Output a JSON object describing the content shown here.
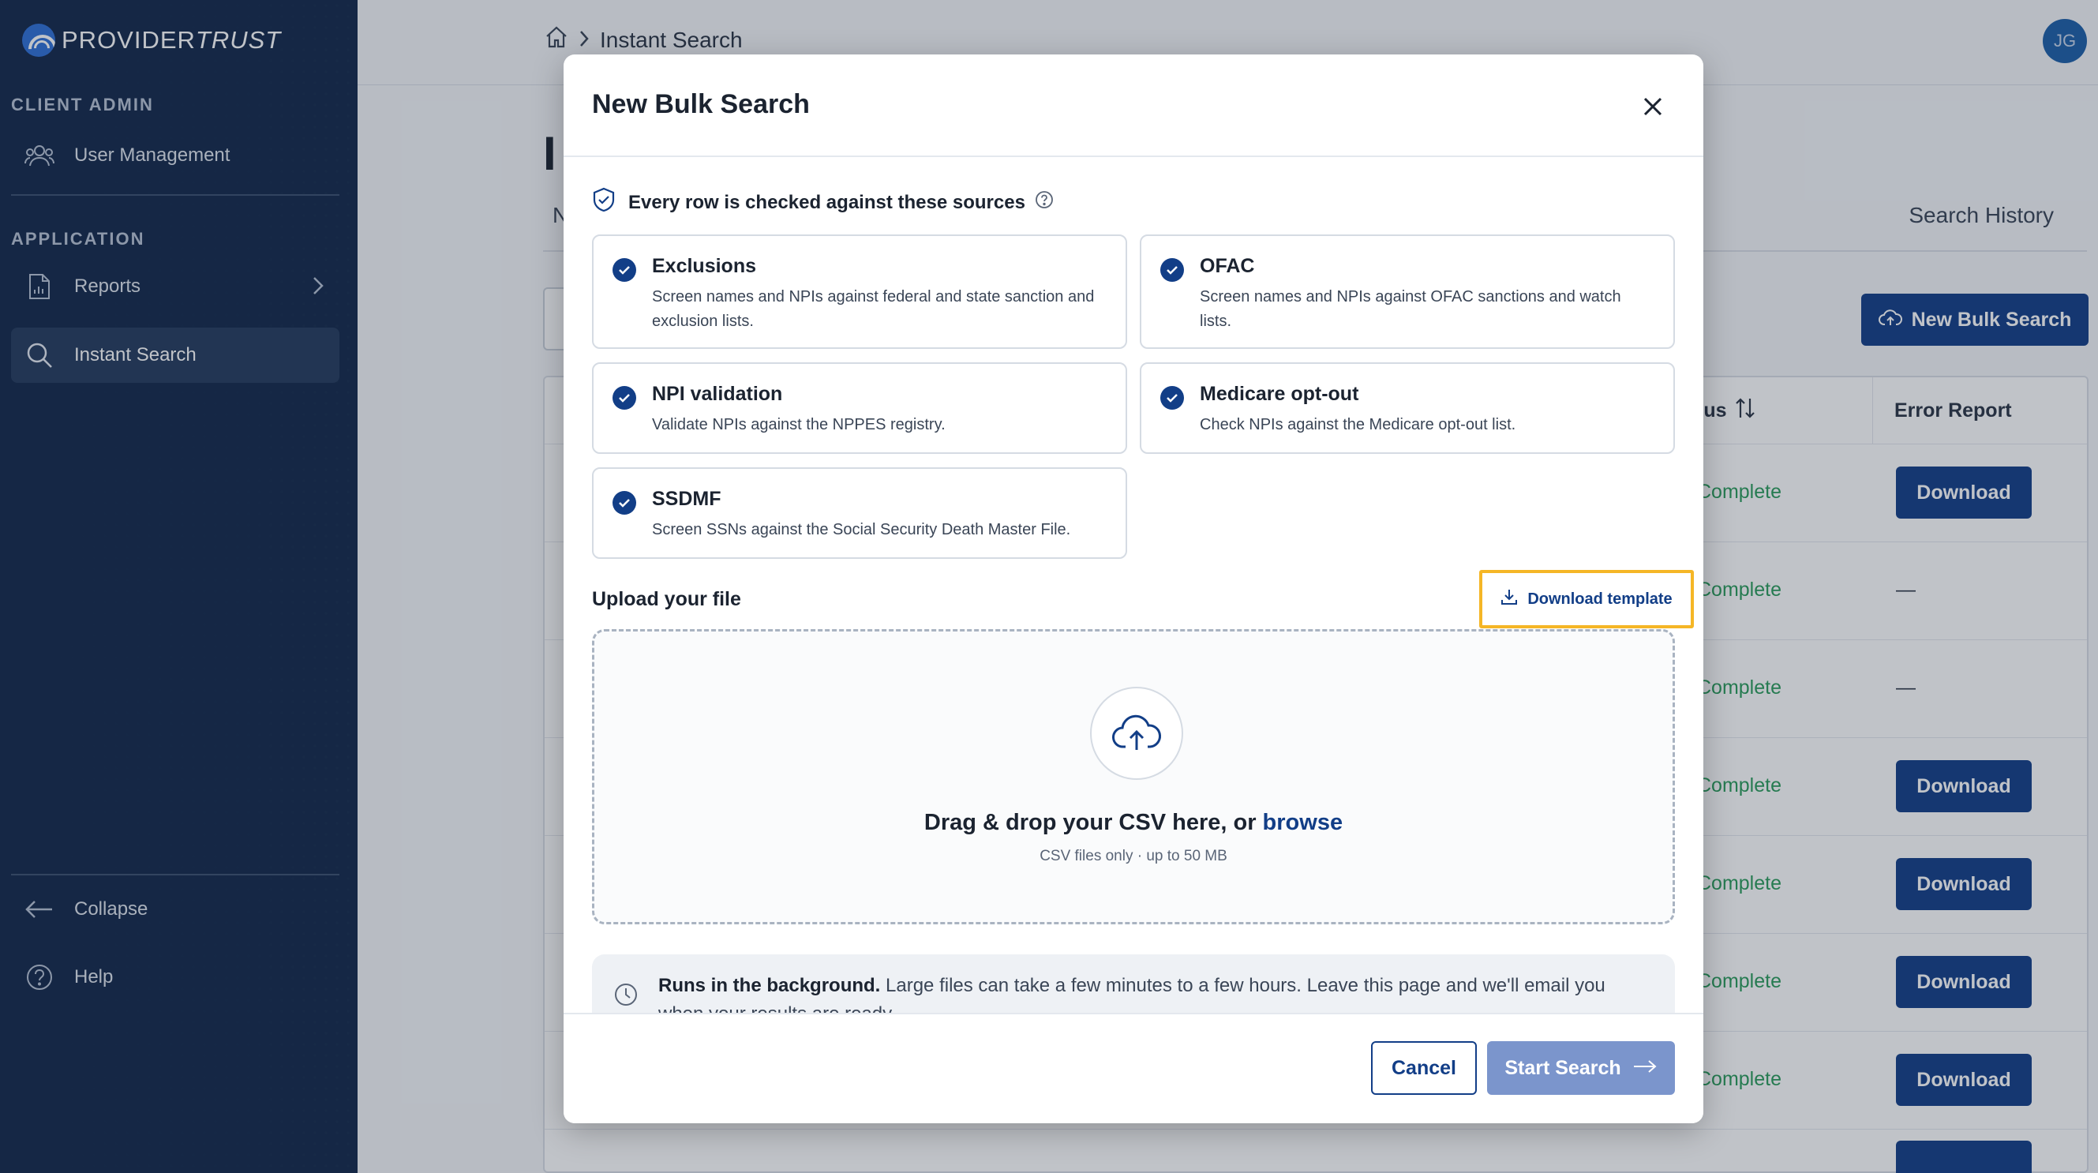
{
  "sidebar": {
    "logo_primary": "PROVIDER",
    "logo_secondary": "TRUST",
    "section_client_admin": "CLIENT ADMIN",
    "user_management": "User Management",
    "section_application": "APPLICATION",
    "reports": "Reports",
    "instant_search": "Instant Search",
    "collapse": "Collapse",
    "help": "Help"
  },
  "topbar": {
    "breadcrumb_current": "Instant Search",
    "avatar_initials": "JG"
  },
  "background": {
    "title_partial": "I",
    "tab_partial": "N",
    "tab_history": "Search History",
    "new_bulk_button": "New Bulk Search",
    "col_status_partial": "tus",
    "col_error_report": "Error Report",
    "rows": [
      {
        "status": "Complete",
        "report": "Download"
      },
      {
        "status": "Complete",
        "report": "—"
      },
      {
        "status": "Complete",
        "report": "—"
      },
      {
        "status": "Complete",
        "report": "Download"
      },
      {
        "status": "Complete",
        "report": "Download"
      },
      {
        "status": "Complete",
        "report": "Download"
      },
      {
        "status": "Complete",
        "report": "Download"
      }
    ]
  },
  "modal": {
    "title": "New Bulk Search",
    "sources_heading": "Every row is checked against these sources",
    "sources": [
      {
        "title": "Exclusions",
        "desc": "Screen names and NPIs against federal and state sanction and exclusion lists."
      },
      {
        "title": "OFAC",
        "desc": "Screen names and NPIs against OFAC sanctions and watch lists."
      },
      {
        "title": "NPI validation",
        "desc": "Validate NPIs against the NPPES registry."
      },
      {
        "title": "Medicare opt-out",
        "desc": "Check NPIs against the Medicare opt-out list."
      },
      {
        "title": "SSDMF",
        "desc": "Screen SSNs against the Social Security Death Master File."
      }
    ],
    "upload_label": "Upload your file",
    "download_template": "Download template",
    "drop_text": "Drag & drop your CSV here, or",
    "browse": "browse",
    "drop_sub": "CSV files only · up to 50 MB",
    "note_bold": "Runs in the background.",
    "note_text": "Large files can take a few minutes to a few hours. Leave this page and we'll email you when your results are ready.",
    "cancel": "Cancel",
    "start": "Start Search"
  },
  "colors": {
    "sidebar_bg": "#12284a",
    "primary": "#123e87",
    "start_disabled": "#7b95cc",
    "status_green": "#2a9c5a",
    "highlight": "#f5b626"
  }
}
